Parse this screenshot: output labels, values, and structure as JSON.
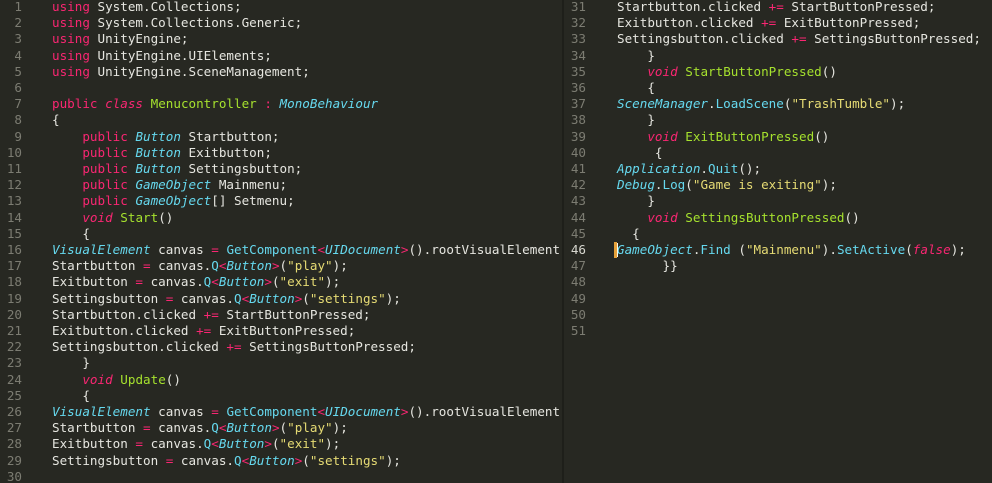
{
  "editor": {
    "left_pane": {
      "lines": [
        {
          "n": "1",
          "x": 52,
          "tokens": [
            {
              "t": "using",
              "c": "kw"
            },
            {
              "t": " System.Collections;"
            }
          ]
        },
        {
          "n": "2",
          "x": 52,
          "tokens": [
            {
              "t": "using",
              "c": "kw"
            },
            {
              "t": " System.Collections.Generic;"
            }
          ]
        },
        {
          "n": "3",
          "x": 52,
          "tokens": [
            {
              "t": "using",
              "c": "kw"
            },
            {
              "t": " UnityEngine;"
            }
          ]
        },
        {
          "n": "4",
          "x": 52,
          "tokens": [
            {
              "t": "using",
              "c": "kw"
            },
            {
              "t": " UnityEngine.UIElements;"
            }
          ]
        },
        {
          "n": "5",
          "x": 52,
          "tokens": [
            {
              "t": "using",
              "c": "kw"
            },
            {
              "t": " UnityEngine.SceneManagement;"
            }
          ]
        },
        {
          "n": "6",
          "x": 52,
          "tokens": []
        },
        {
          "n": "7",
          "x": 52,
          "tokens": [
            {
              "t": "public",
              "c": "kw"
            },
            {
              "t": " "
            },
            {
              "t": "class",
              "c": "kwi"
            },
            {
              "t": " "
            },
            {
              "t": "Menucontroller",
              "c": "cls"
            },
            {
              "t": " "
            },
            {
              "t": ":",
              "c": "op"
            },
            {
              "t": " "
            },
            {
              "t": "MonoBehaviour",
              "c": "ty"
            }
          ]
        },
        {
          "n": "8",
          "x": 52,
          "tokens": [
            {
              "t": "{"
            }
          ]
        },
        {
          "n": "9",
          "x": 52,
          "tokens": [
            {
              "t": "    "
            },
            {
              "t": "public",
              "c": "kw"
            },
            {
              "t": " "
            },
            {
              "t": "Button",
              "c": "ty"
            },
            {
              "t": " Startbutton;"
            }
          ]
        },
        {
          "n": "10",
          "x": 52,
          "tokens": [
            {
              "t": "    "
            },
            {
              "t": "public",
              "c": "kw"
            },
            {
              "t": " "
            },
            {
              "t": "Button",
              "c": "ty"
            },
            {
              "t": " Exitbutton;"
            }
          ]
        },
        {
          "n": "11",
          "x": 52,
          "tokens": [
            {
              "t": "    "
            },
            {
              "t": "public",
              "c": "kw"
            },
            {
              "t": " "
            },
            {
              "t": "Button",
              "c": "ty"
            },
            {
              "t": " Settingsbutton;"
            }
          ]
        },
        {
          "n": "12",
          "x": 52,
          "tokens": [
            {
              "t": "    "
            },
            {
              "t": "public",
              "c": "kw"
            },
            {
              "t": " "
            },
            {
              "t": "GameObject",
              "c": "ty"
            },
            {
              "t": " Mainmenu;"
            }
          ]
        },
        {
          "n": "13",
          "x": 52,
          "tokens": [
            {
              "t": "    "
            },
            {
              "t": "public",
              "c": "kw"
            },
            {
              "t": " "
            },
            {
              "t": "GameObject",
              "c": "ty"
            },
            {
              "t": "[] Setmenu;"
            }
          ]
        },
        {
          "n": "14",
          "x": 52,
          "tokens": [
            {
              "t": "    "
            },
            {
              "t": "void",
              "c": "kwi"
            },
            {
              "t": " "
            },
            {
              "t": "Start",
              "c": "fn"
            },
            {
              "t": "()"
            }
          ]
        },
        {
          "n": "15",
          "x": 52,
          "tokens": [
            {
              "t": "    {"
            }
          ]
        },
        {
          "n": "16",
          "x": 52,
          "tokens": [
            {
              "t": "VisualElement",
              "c": "ty"
            },
            {
              "t": " canvas "
            },
            {
              "t": "=",
              "c": "op"
            },
            {
              "t": " "
            },
            {
              "t": "GetComponent",
              "c": "m"
            },
            {
              "t": "<",
              "c": "op"
            },
            {
              "t": "UIDocument",
              "c": "ty"
            },
            {
              "t": ">",
              "c": "op"
            },
            {
              "t": "().rootVisualElement"
            }
          ]
        },
        {
          "n": "17",
          "x": 52,
          "tokens": [
            {
              "t": "Startbutton "
            },
            {
              "t": "=",
              "c": "op"
            },
            {
              "t": " canvas."
            },
            {
              "t": "Q",
              "c": "m"
            },
            {
              "t": "<",
              "c": "op"
            },
            {
              "t": "Button",
              "c": "ty"
            },
            {
              "t": ">",
              "c": "op"
            },
            {
              "t": "("
            },
            {
              "t": "\"play\"",
              "c": "s"
            },
            {
              "t": ");"
            }
          ]
        },
        {
          "n": "18",
          "x": 52,
          "tokens": [
            {
              "t": "Exitbutton "
            },
            {
              "t": "=",
              "c": "op"
            },
            {
              "t": " canvas."
            },
            {
              "t": "Q",
              "c": "m"
            },
            {
              "t": "<",
              "c": "op"
            },
            {
              "t": "Button",
              "c": "ty"
            },
            {
              "t": ">",
              "c": "op"
            },
            {
              "t": "("
            },
            {
              "t": "\"exit\"",
              "c": "s"
            },
            {
              "t": ");"
            }
          ]
        },
        {
          "n": "19",
          "x": 52,
          "tokens": [
            {
              "t": "Settingsbutton "
            },
            {
              "t": "=",
              "c": "op"
            },
            {
              "t": " canvas."
            },
            {
              "t": "Q",
              "c": "m"
            },
            {
              "t": "<",
              "c": "op"
            },
            {
              "t": "Button",
              "c": "ty"
            },
            {
              "t": ">",
              "c": "op"
            },
            {
              "t": "("
            },
            {
              "t": "\"settings\"",
              "c": "s"
            },
            {
              "t": ");"
            }
          ]
        },
        {
          "n": "20",
          "x": 52,
          "tokens": [
            {
              "t": "Startbutton.clicked "
            },
            {
              "t": "+=",
              "c": "op"
            },
            {
              "t": " StartButtonPressed;"
            }
          ]
        },
        {
          "n": "21",
          "x": 52,
          "tokens": [
            {
              "t": "Exitbutton.clicked "
            },
            {
              "t": "+=",
              "c": "op"
            },
            {
              "t": " ExitButtonPressed;"
            }
          ]
        },
        {
          "n": "22",
          "x": 52,
          "tokens": [
            {
              "t": "Settingsbutton.clicked "
            },
            {
              "t": "+=",
              "c": "op"
            },
            {
              "t": " SettingsButtonPressed;"
            }
          ]
        },
        {
          "n": "23",
          "x": 52,
          "tokens": [
            {
              "t": "    }"
            }
          ]
        },
        {
          "n": "24",
          "x": 52,
          "tokens": [
            {
              "t": "    "
            },
            {
              "t": "void",
              "c": "kwi"
            },
            {
              "t": " "
            },
            {
              "t": "Update",
              "c": "fn"
            },
            {
              "t": "()"
            }
          ]
        },
        {
          "n": "25",
          "x": 52,
          "tokens": [
            {
              "t": "    {"
            }
          ]
        },
        {
          "n": "26",
          "x": 52,
          "tokens": [
            {
              "t": "VisualElement",
              "c": "ty"
            },
            {
              "t": " canvas "
            },
            {
              "t": "=",
              "c": "op"
            },
            {
              "t": " "
            },
            {
              "t": "GetComponent",
              "c": "m"
            },
            {
              "t": "<",
              "c": "op"
            },
            {
              "t": "UIDocument",
              "c": "ty"
            },
            {
              "t": ">",
              "c": "op"
            },
            {
              "t": "().rootVisualElement"
            }
          ]
        },
        {
          "n": "27",
          "x": 52,
          "tokens": [
            {
              "t": "Startbutton "
            },
            {
              "t": "=",
              "c": "op"
            },
            {
              "t": " canvas."
            },
            {
              "t": "Q",
              "c": "m"
            },
            {
              "t": "<",
              "c": "op"
            },
            {
              "t": "Button",
              "c": "ty"
            },
            {
              "t": ">",
              "c": "op"
            },
            {
              "t": "("
            },
            {
              "t": "\"play\"",
              "c": "s"
            },
            {
              "t": ");"
            }
          ]
        },
        {
          "n": "28",
          "x": 52,
          "tokens": [
            {
              "t": "Exitbutton "
            },
            {
              "t": "=",
              "c": "op"
            },
            {
              "t": " canvas."
            },
            {
              "t": "Q",
              "c": "m"
            },
            {
              "t": "<",
              "c": "op"
            },
            {
              "t": "Button",
              "c": "ty"
            },
            {
              "t": ">",
              "c": "op"
            },
            {
              "t": "("
            },
            {
              "t": "\"exit\"",
              "c": "s"
            },
            {
              "t": ");"
            }
          ]
        },
        {
          "n": "29",
          "x": 52,
          "tokens": [
            {
              "t": "Settingsbutton "
            },
            {
              "t": "=",
              "c": "op"
            },
            {
              "t": " canvas."
            },
            {
              "t": "Q",
              "c": "m"
            },
            {
              "t": "<",
              "c": "op"
            },
            {
              "t": "Button",
              "c": "ty"
            },
            {
              "t": ">",
              "c": "op"
            },
            {
              "t": "("
            },
            {
              "t": "\"settings\"",
              "c": "s"
            },
            {
              "t": ");"
            }
          ]
        },
        {
          "n": "30",
          "x": 52,
          "tokens": []
        }
      ]
    },
    "right_pane": {
      "lines": [
        {
          "n": "31",
          "x": 53,
          "tokens": [
            {
              "t": "Startbutton.clicked "
            },
            {
              "t": "+=",
              "c": "op"
            },
            {
              "t": " StartButtonPressed;"
            }
          ]
        },
        {
          "n": "32",
          "x": 53,
          "tokens": [
            {
              "t": "Exitbutton.clicked "
            },
            {
              "t": "+=",
              "c": "op"
            },
            {
              "t": " ExitButtonPressed;"
            }
          ]
        },
        {
          "n": "33",
          "x": 53,
          "tokens": [
            {
              "t": "Settingsbutton.clicked "
            },
            {
              "t": "+=",
              "c": "op"
            },
            {
              "t": " SettingsButtonPressed;"
            }
          ]
        },
        {
          "n": "34",
          "x": 53,
          "tokens": [
            {
              "t": "    }"
            }
          ]
        },
        {
          "n": "35",
          "x": 53,
          "tokens": [
            {
              "t": "    "
            },
            {
              "t": "void",
              "c": "kwi"
            },
            {
              "t": " "
            },
            {
              "t": "StartButtonPressed",
              "c": "fn"
            },
            {
              "t": "()"
            }
          ]
        },
        {
          "n": "36",
          "x": 53,
          "tokens": [
            {
              "t": "    {"
            }
          ]
        },
        {
          "n": "37",
          "x": 53,
          "tokens": [
            {
              "t": "SceneManager",
              "c": "ty"
            },
            {
              "t": "."
            },
            {
              "t": "LoadScene",
              "c": "m"
            },
            {
              "t": "("
            },
            {
              "t": "\"TrashTumble\"",
              "c": "s"
            },
            {
              "t": ");"
            }
          ]
        },
        {
          "n": "38",
          "x": 53,
          "tokens": [
            {
              "t": "    }"
            }
          ]
        },
        {
          "n": "39",
          "x": 53,
          "tokens": [
            {
              "t": "    "
            },
            {
              "t": "void",
              "c": "kwi"
            },
            {
              "t": " "
            },
            {
              "t": "ExitButtonPressed",
              "c": "fn"
            },
            {
              "t": "()"
            }
          ]
        },
        {
          "n": "40",
          "x": 53,
          "tokens": [
            {
              "t": "     {"
            }
          ]
        },
        {
          "n": "41",
          "x": 53,
          "tokens": [
            {
              "t": "Application",
              "c": "ty"
            },
            {
              "t": "."
            },
            {
              "t": "Quit",
              "c": "m"
            },
            {
              "t": "();"
            }
          ]
        },
        {
          "n": "42",
          "x": 53,
          "tokens": [
            {
              "t": "Debug",
              "c": "ty"
            },
            {
              "t": "."
            },
            {
              "t": "Log",
              "c": "m"
            },
            {
              "t": "("
            },
            {
              "t": "\"Game is exiting\"",
              "c": "s"
            },
            {
              "t": ");"
            }
          ]
        },
        {
          "n": "43",
          "x": 53,
          "tokens": [
            {
              "t": "    }"
            }
          ]
        },
        {
          "n": "44",
          "x": 53,
          "tokens": [
            {
              "t": "    "
            },
            {
              "t": "void",
              "c": "kwi"
            },
            {
              "t": " "
            },
            {
              "t": "SettingsButtonPressed",
              "c": "fn"
            },
            {
              "t": "()"
            }
          ]
        },
        {
          "n": "45",
          "x": 53,
          "tokens": [
            {
              "t": "  {"
            }
          ]
        },
        {
          "n": "46",
          "x": 53,
          "active": true,
          "tokens": [
            {
              "t": "GameObject",
              "c": "ty"
            },
            {
              "t": "."
            },
            {
              "t": "Find",
              "c": "m"
            },
            {
              "t": " ("
            },
            {
              "t": "\"Mainmenu\"",
              "c": "s"
            },
            {
              "t": ")."
            },
            {
              "t": "SetActive",
              "c": "m"
            },
            {
              "t": "("
            },
            {
              "t": "false",
              "c": "kwi"
            },
            {
              "t": ");"
            }
          ]
        },
        {
          "n": "47",
          "x": 53,
          "tokens": [
            {
              "t": "      }}"
            }
          ]
        },
        {
          "n": "48",
          "x": 53,
          "tokens": []
        },
        {
          "n": "49",
          "x": 53,
          "tokens": []
        },
        {
          "n": "50",
          "x": 53,
          "tokens": []
        },
        {
          "n": "51",
          "x": 53,
          "tokens": []
        }
      ]
    }
  }
}
